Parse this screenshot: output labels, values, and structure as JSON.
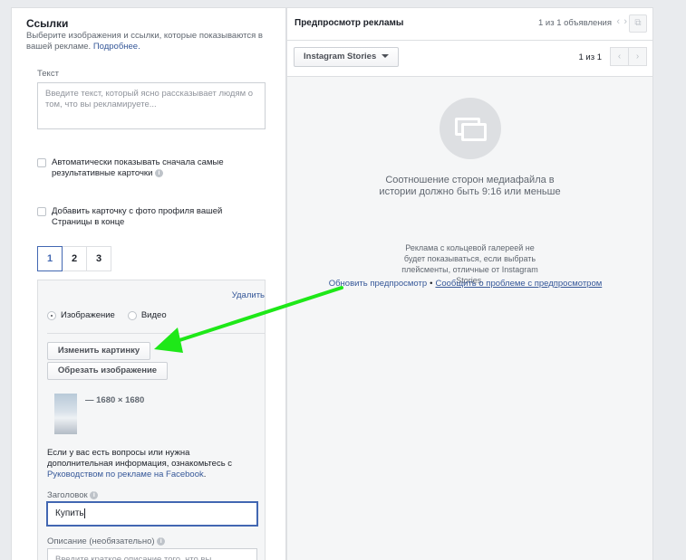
{
  "left": {
    "title": "Ссылки",
    "subtitle": "Выберите изображения и ссылки, которые показываются в вашей рекламе.",
    "more_link": "Подробнее.",
    "text_label": "Текст",
    "text_placeholder": "Введите текст, который ясно рассказывает людям о том, что вы рекламируете...",
    "checkbox_auto": "Автоматически показывать сначала самые результативные карточки",
    "checkbox_profile": "Добавить карточку с фото профиля вашей Страницы в конце",
    "tabs": [
      "1",
      "2",
      "3"
    ],
    "active_tab": "1",
    "card": {
      "delete": "Удалить",
      "radio_image": "Изображение",
      "radio_video": "Видео",
      "change_image": "Изменить картинку",
      "crop_image": "Обрезать изображение",
      "dimensions": "— 1680 × 1680",
      "help_text": "Если у вас есть вопросы или нужна дополнительная информация, ознакомьтесь с",
      "help_link": "Руководством по рекламе на Facebook",
      "help_end": ".",
      "headline_label": "Заголовок",
      "headline_value": "Купить",
      "description_label": "Описание (необязательно)",
      "description_placeholder": "Введите краткое описание того, что вы"
    }
  },
  "preview": {
    "title": "Предпросмотр рекламы",
    "count": "1 из 1 объявления",
    "placement": "Instagram Stories",
    "pager": "1 из 1",
    "ratio_msg": "Соотношение сторон медиафайла в истории должно быть 9:16 или меньше",
    "carousel_msg": "Реклама с кольцевой галереей не будет показываться, если выбрать плейсменты, отличные от Instagram Stories.",
    "refresh_link": "Обновить предпросмотр",
    "separator": "•",
    "report_link": "Сообщить о проблеме с предпросмотром"
  },
  "colors": {
    "accent": "#4267b2",
    "arrow": "#1ee818"
  },
  "icons": [
    "info-icon",
    "chevron-left-icon",
    "chevron-right-icon",
    "external-link-icon",
    "dropdown-caret-icon",
    "media-gallery-icon"
  ]
}
